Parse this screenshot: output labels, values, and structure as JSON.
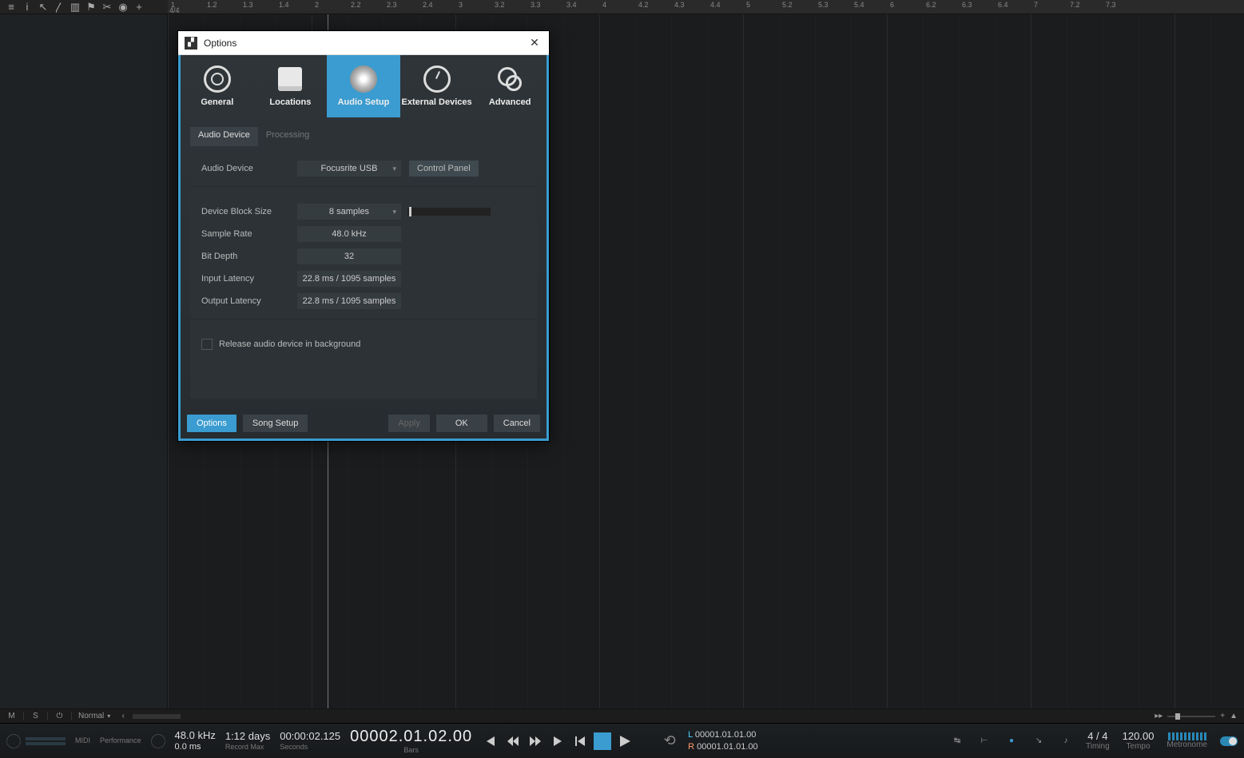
{
  "toolbar_icons": [
    "menu",
    "info",
    "arrow",
    "draw",
    "paint",
    "flag",
    "cut",
    "speaker",
    "plus"
  ],
  "ruler": {
    "timesig": "4/4",
    "ticks": [
      "1",
      "1.2",
      "1.3",
      "1.4",
      "2",
      "2.2",
      "2.3",
      "2.4",
      "3",
      "3.2",
      "3.3",
      "3.4",
      "4",
      "4.2",
      "4.3",
      "4.4",
      "5",
      "5.2",
      "5.3",
      "5.4",
      "6",
      "6.2",
      "6.3",
      "6.4",
      "7",
      "7.2",
      "7.3"
    ]
  },
  "bottomstrip": {
    "m": "M",
    "s": "S",
    "mode": "Normal"
  },
  "transport": {
    "perf_label": "Performance",
    "midi_label": "MIDI",
    "sample_rate": "48.0 kHz",
    "dropout": "0.0 ms",
    "rec_time": "1:12 days",
    "rec_label": "Record Max",
    "seconds": "00:00:02.125",
    "seconds_label": "Seconds",
    "bars": "00002.01.02.00",
    "bars_label": "Bars",
    "loc_L": "00001.01.01.00",
    "loc_R": "00001.01.01.00",
    "timesig": "4 / 4",
    "tempo": "120.00",
    "metronome_label": "Metronome",
    "timing_label": "Timing",
    "tempo_label": "Tempo"
  },
  "dialog": {
    "title": "Options",
    "tabs": {
      "general": "General",
      "locations": "Locations",
      "audio": "Audio Setup",
      "external": "External Devices",
      "advanced": "Advanced"
    },
    "subtabs": {
      "device": "Audio Device",
      "processing": "Processing"
    },
    "labels": {
      "audio_device": "Audio Device",
      "block_size": "Device Block Size",
      "sample_rate": "Sample Rate",
      "bit_depth": "Bit Depth",
      "in_latency": "Input Latency",
      "out_latency": "Output Latency",
      "release": "Release audio device in background",
      "control_panel": "Control Panel"
    },
    "values": {
      "audio_device": "Focusrite USB",
      "block_size": "8 samples",
      "sample_rate": "48.0 kHz",
      "bit_depth": "32",
      "in_latency": "22.8 ms / 1095 samples",
      "out_latency": "22.8 ms / 1095 samples"
    },
    "footer": {
      "options": "Options",
      "song_setup": "Song Setup",
      "apply": "Apply",
      "ok": "OK",
      "cancel": "Cancel"
    }
  }
}
